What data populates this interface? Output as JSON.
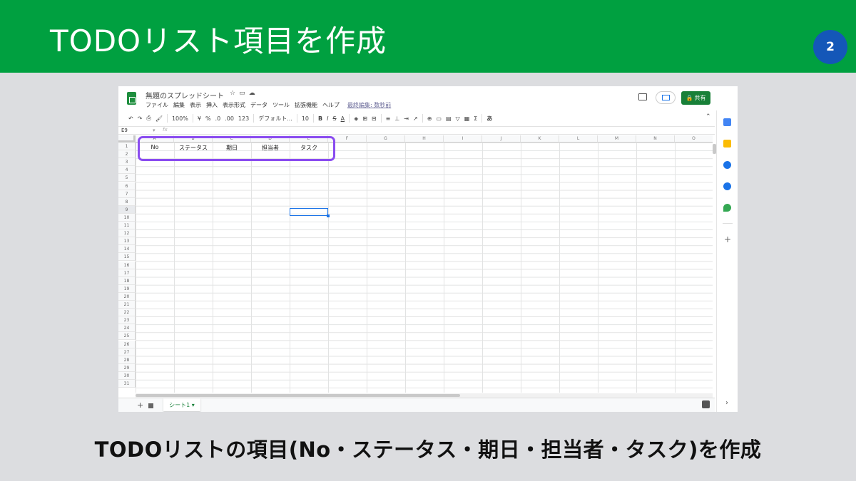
{
  "slide": {
    "title": "TODOリスト項目を作成",
    "page_number": "2",
    "caption": "TODOリストの項目(No・ステータス・期日・担当者・タスク)を作成"
  },
  "app": {
    "doc_title": "無題のスプレッドシート",
    "menu": [
      "ファイル",
      "編集",
      "表示",
      "挿入",
      "表示形式",
      "データ",
      "ツール",
      "拡張機能",
      "ヘルプ"
    ],
    "last_edit": "最終編集: 数秒前",
    "share_label": "共有"
  },
  "toolbar": {
    "zoom": "100%",
    "currency": "¥",
    "percent": "%",
    "dec_decrease": ".0",
    "dec_increase": ".00",
    "format_more": "123",
    "font": "デフォルト...",
    "font_size": "10",
    "bold": "B",
    "italic": "I",
    "strike": "S",
    "text_color": "A",
    "input_tools": "あ"
  },
  "formula_bar": {
    "name_box": "E9",
    "fx": "fx"
  },
  "columns": [
    "A",
    "B",
    "C",
    "D",
    "E",
    "F",
    "G",
    "H",
    "I",
    "J",
    "K",
    "L",
    "M",
    "N",
    "O"
  ],
  "rows": [
    "1",
    "2",
    "3",
    "4",
    "5",
    "6",
    "7",
    "8",
    "9",
    "10",
    "11",
    "12",
    "13",
    "14",
    "15",
    "16",
    "17",
    "18",
    "19",
    "20",
    "21",
    "22",
    "23",
    "24",
    "25",
    "26",
    "27",
    "28",
    "29",
    "30",
    "31"
  ],
  "cells": {
    "A1": "No",
    "B1": "ステータス",
    "C1": "期日",
    "D1": "担当者",
    "E1": "タスク"
  },
  "sheet_tab": "シート1",
  "colors": {
    "header_green": "#00a040",
    "badge_blue": "#1457b8",
    "highlight_purple": "#8a4cf0",
    "share_green": "#188038",
    "selection_blue": "#1a73e8"
  }
}
